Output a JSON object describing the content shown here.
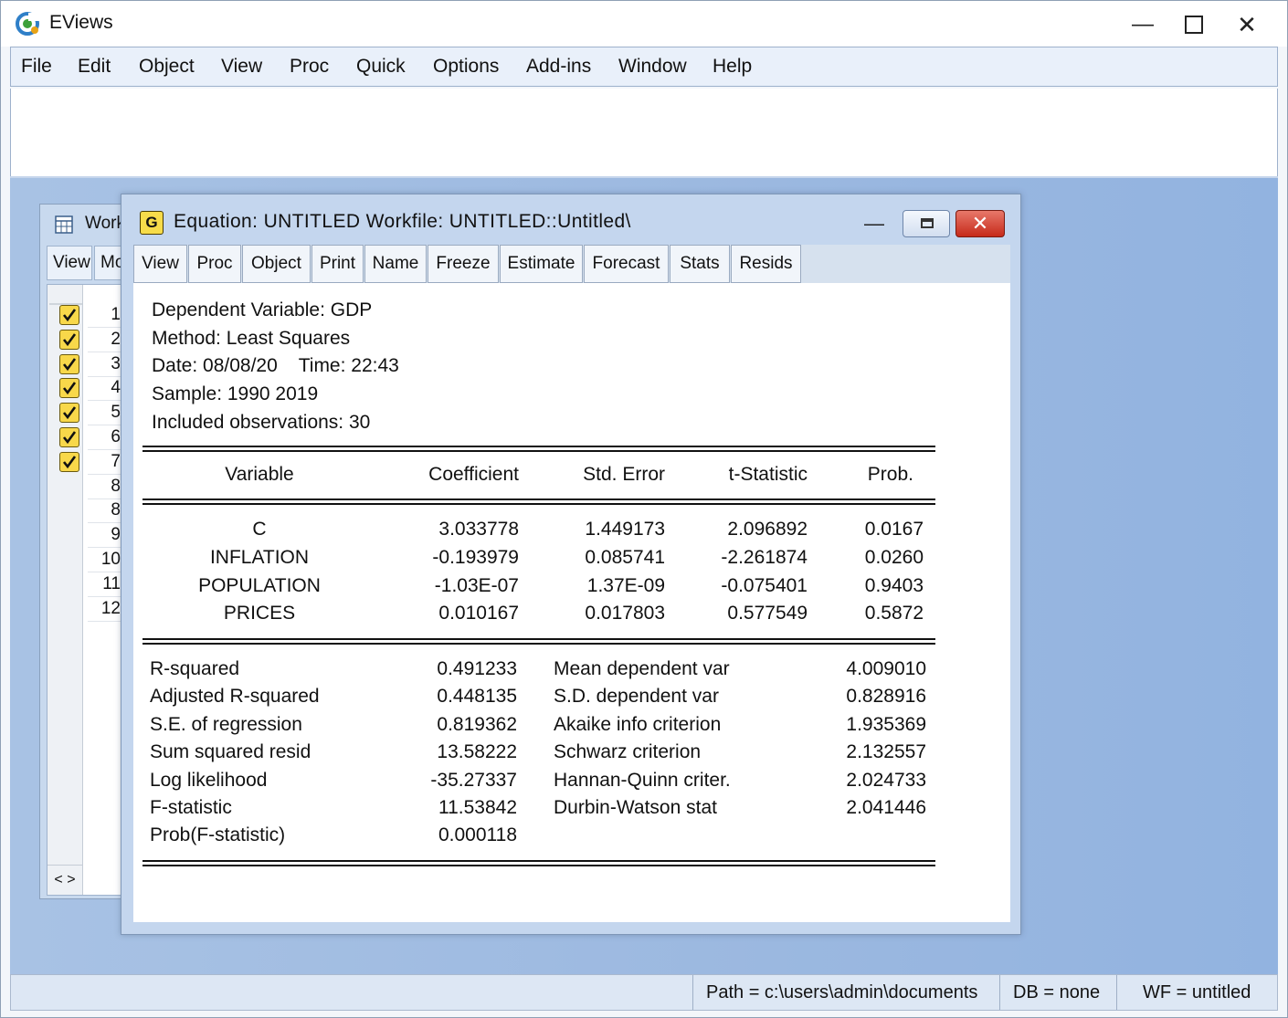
{
  "app": {
    "title": "EViews",
    "menu": [
      "File",
      "Edit",
      "Object",
      "View",
      "Proc",
      "Quick",
      "Options",
      "Add-ins",
      "Window",
      "Help"
    ]
  },
  "workfile_window": {
    "title": "Work",
    "buttons": [
      "View",
      "Mo"
    ],
    "rows": [
      "1",
      "2",
      "3",
      "4",
      "5",
      "6",
      "7",
      "8",
      "8",
      "9",
      "10",
      "11",
      "12"
    ],
    "checked_rows": 7,
    "scroll_left": "<",
    "scroll_right": ">"
  },
  "equation_window": {
    "icon_letter": "G",
    "title": "Equation:  UNTITLED   Workfile:  UNTITLED::Untitled\\",
    "toolbar": [
      "View",
      "Proc",
      "Object",
      "Print",
      "Name",
      "Freeze",
      "Estimate",
      "Forecast",
      "Stats",
      "Resids"
    ],
    "header": [
      "Dependent Variable: GDP",
      "Method: Least Squares",
      "Date: 08/08/20    Time: 22:43",
      "Sample: 1990 2019",
      "Included observations: 30"
    ],
    "coef_table": {
      "columns": [
        "Variable",
        "Coefficient",
        "Std. Error",
        "t-Statistic",
        "Prob."
      ],
      "rows": [
        [
          "C",
          "3.033778",
          "1.449173",
          "2.096892",
          "0.0167"
        ],
        [
          "INFLATION",
          "-0.193979",
          "0.085741",
          "-2.261874",
          "0.0260"
        ],
        [
          "POPULATION",
          "-1.03E-07",
          "1.37E-09",
          "-0.075401",
          "0.9403"
        ],
        [
          "PRICES",
          "0.010167",
          "0.017803",
          "0.577549",
          "0.5872"
        ]
      ]
    },
    "stats_left": [
      [
        "R-squared",
        "0.491233"
      ],
      [
        "Adjusted R-squared",
        "0.448135"
      ],
      [
        "S.E. of regression",
        "0.819362"
      ],
      [
        "Sum squared resid",
        "13.58222"
      ],
      [
        "Log likelihood",
        "-35.27337"
      ],
      [
        "F-statistic",
        "11.53842"
      ],
      [
        "Prob(F-statistic)",
        "0.000118"
      ]
    ],
    "stats_right": [
      [
        "Mean dependent var",
        "4.009010"
      ],
      [
        "S.D. dependent var",
        "0.828916"
      ],
      [
        "Akaike info criterion",
        "1.935369"
      ],
      [
        "Schwarz criterion",
        "2.132557"
      ],
      [
        "Hannan-Quinn criter.",
        "2.024733"
      ],
      [
        "Durbin-Watson stat",
        "2.041446"
      ]
    ]
  },
  "statusbar": {
    "path": "Path = c:\\users\\admin\\documents",
    "db": "DB = none",
    "wf": "WF = untitled"
  },
  "colors": {
    "mdi_background": "#9bb8e0",
    "window_frame": "#c4d6ee",
    "close_button": "#c62a1a",
    "check_yellow": "#f8d84a"
  }
}
